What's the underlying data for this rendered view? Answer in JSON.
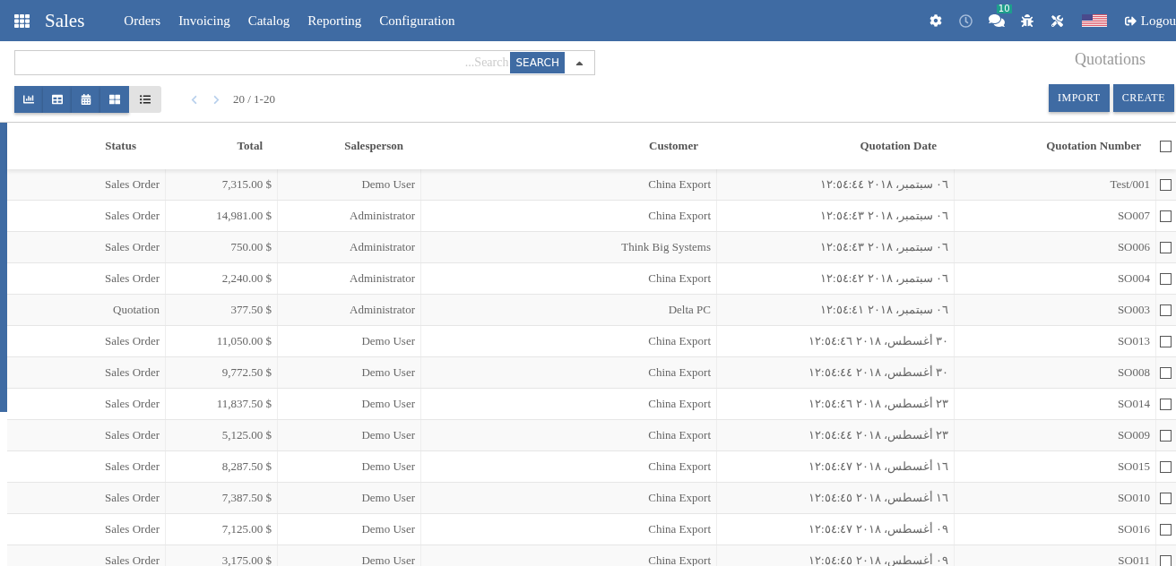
{
  "navbar": {
    "app_title": "Sales",
    "menu": [
      "Orders",
      "Invoicing",
      "Catalog",
      "Reporting",
      "Configuration"
    ],
    "messages_badge": "10",
    "logout": "Logou"
  },
  "control_panel": {
    "search": {
      "placeholder": "...Search",
      "button": "SEARCH"
    },
    "title": "Quotations",
    "views": [
      {
        "kind": "graph",
        "selected": false
      },
      {
        "kind": "pivot",
        "selected": false
      },
      {
        "kind": "calendar",
        "selected": false
      },
      {
        "kind": "kanban",
        "selected": false
      },
      {
        "kind": "list",
        "selected": true
      }
    ],
    "pager": "20 / 1-20",
    "buttons": [
      "IMPORT",
      "CREATE"
    ]
  },
  "table": {
    "columns": [
      "Status",
      "Total",
      "Salesperson",
      "Customer",
      "Quotation Date",
      "Quotation Number"
    ],
    "rows": [
      {
        "cells": [
          "Sales Order",
          "7,315.00 $",
          "Demo User",
          "China Export",
          "٠٦ سبتمبر، ٢٠١٨ ١٢:٥٤:٤٤",
          "Test/001"
        ],
        "checked": false
      },
      {
        "cells": [
          "Sales Order",
          "14,981.00 $",
          "Administrator",
          "China Export",
          "٠٦ سبتمبر، ٢٠١٨ ١٢:٥٤:٤٣",
          "SO007"
        ],
        "checked": false
      },
      {
        "cells": [
          "Sales Order",
          "750.00 $",
          "Administrator",
          "Think Big Systems",
          "٠٦ سبتمبر، ٢٠١٨ ١٢:٥٤:٤٣",
          "SO006"
        ],
        "checked": false
      },
      {
        "cells": [
          "Sales Order",
          "2,240.00 $",
          "Administrator",
          "China Export",
          "٠٦ سبتمبر، ٢٠١٨ ١٢:٥٤:٤٢",
          "SO004"
        ],
        "checked": false
      },
      {
        "cells": [
          "Quotation",
          "377.50 $",
          "Administrator",
          "Delta PC",
          "٠٦ سبتمبر، ٢٠١٨ ١٢:٥٤:٤١",
          "SO003"
        ],
        "checked": false
      },
      {
        "cells": [
          "Sales Order",
          "11,050.00 $",
          "Demo User",
          "China Export",
          "٣٠ أغسطس، ٢٠١٨ ١٢:٥٤:٤٦",
          "SO013"
        ],
        "checked": false
      },
      {
        "cells": [
          "Sales Order",
          "9,772.50 $",
          "Demo User",
          "China Export",
          "٣٠ أغسطس، ٢٠١٨ ١٢:٥٤:٤٤",
          "SO008"
        ],
        "checked": false
      },
      {
        "cells": [
          "Sales Order",
          "11,837.50 $",
          "Demo User",
          "China Export",
          "٢٣ أغسطس، ٢٠١٨ ١٢:٥٤:٤٦",
          "SO014"
        ],
        "checked": false
      },
      {
        "cells": [
          "Sales Order",
          "5,125.00 $",
          "Demo User",
          "China Export",
          "٢٣ أغسطس، ٢٠١٨ ١٢:٥٤:٤٤",
          "SO009"
        ],
        "checked": false
      },
      {
        "cells": [
          "Sales Order",
          "8,287.50 $",
          "Demo User",
          "China Export",
          "١٦ أغسطس، ٢٠١٨ ١٢:٥٤:٤٧",
          "SO015"
        ],
        "checked": false
      },
      {
        "cells": [
          "Sales Order",
          "7,387.50 $",
          "Demo User",
          "China Export",
          "١٦ أغسطس، ٢٠١٨ ١٢:٥٤:٤٥",
          "SO010"
        ],
        "checked": false
      },
      {
        "cells": [
          "Sales Order",
          "7,125.00 $",
          "Demo User",
          "China Export",
          "٠٩ أغسطس، ٢٠١٨ ١٢:٥٤:٤٧",
          "SO016"
        ],
        "checked": false
      },
      {
        "cells": [
          "Sales Order",
          "3,175.00 $",
          "Demo User",
          "China Export",
          "٠٩ أغسطس، ٢٠١٨ ١٢:٥٤:٤٥",
          "SO011"
        ],
        "checked": false
      }
    ],
    "header_checked": false
  }
}
